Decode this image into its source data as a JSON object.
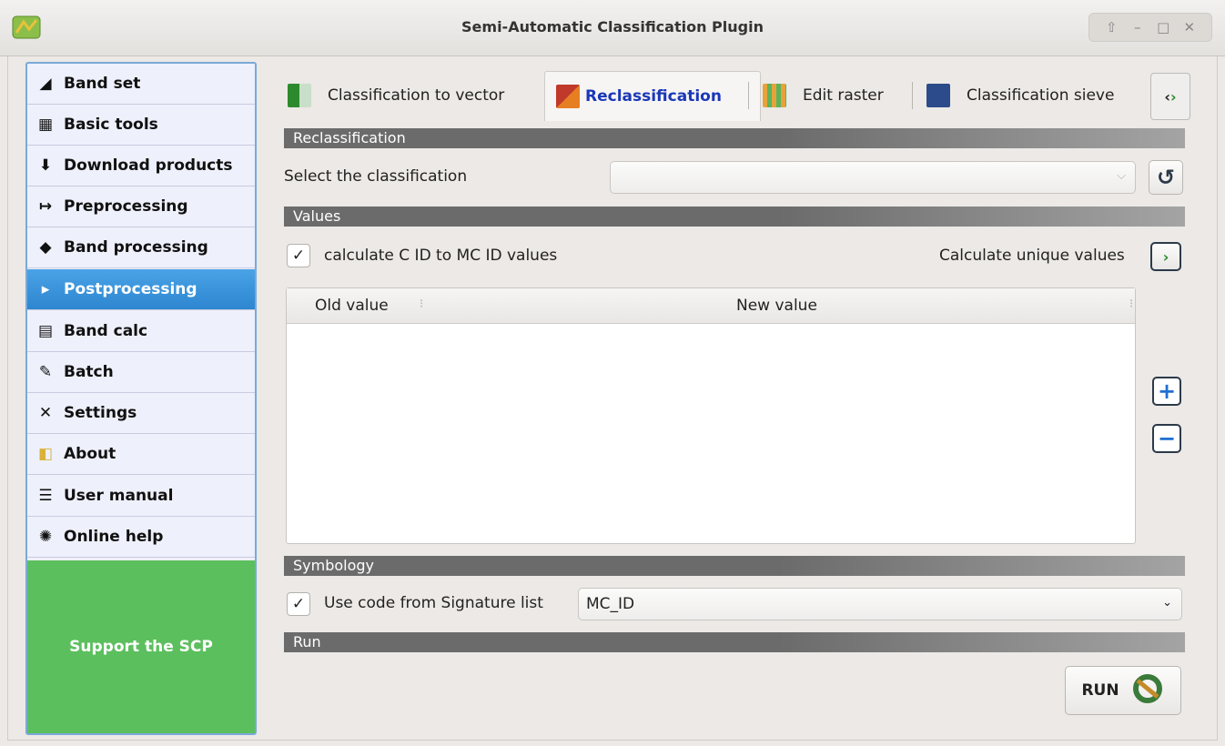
{
  "window": {
    "title": "Semi-Automatic Classification Plugin",
    "controls": [
      "⇧",
      "–",
      "□",
      "✕"
    ]
  },
  "sidebar": {
    "items": [
      {
        "label": "Band set",
        "icon": "band-set-icon"
      },
      {
        "label": "Basic tools",
        "icon": "basic-tools-icon"
      },
      {
        "label": "Download products",
        "icon": "download-icon"
      },
      {
        "label": "Preprocessing",
        "icon": "preprocessing-icon"
      },
      {
        "label": "Band processing",
        "icon": "band-processing-icon"
      },
      {
        "label": "Postprocessing",
        "icon": "postprocessing-icon",
        "active": true
      },
      {
        "label": "Band calc",
        "icon": "band-calc-icon"
      },
      {
        "label": "Batch",
        "icon": "batch-icon"
      },
      {
        "label": "Settings",
        "icon": "settings-icon"
      },
      {
        "label": "About",
        "icon": "about-icon"
      },
      {
        "label": "User manual",
        "icon": "user-manual-icon"
      },
      {
        "label": "Online help",
        "icon": "online-help-icon"
      }
    ],
    "support_label": "Support the SCP"
  },
  "tabs": [
    {
      "label": "Classification to vector",
      "icon": "classification-to-vector-icon"
    },
    {
      "label": "Reclassification",
      "icon": "reclassification-icon",
      "active": true
    },
    {
      "label": "Edit raster",
      "icon": "edit-raster-icon"
    },
    {
      "label": "Classification sieve",
      "icon": "classification-sieve-icon"
    }
  ],
  "sections": {
    "reclassification": "Reclassification",
    "values": "Values",
    "symbology": "Symbology",
    "run": "Run"
  },
  "reclassification": {
    "select_label": "Select the classification",
    "selected": ""
  },
  "values": {
    "calc_checkbox_label": "calculate C ID to MC ID values",
    "calc_checked": true,
    "unique_values_label": "Calculate unique values",
    "table": {
      "columns": [
        "Old value",
        "New value"
      ],
      "rows": []
    }
  },
  "symbology": {
    "checkbox_label": "Use code from Signature list",
    "checked": true,
    "selected": "MC_ID"
  },
  "run": {
    "button_label": "RUN"
  },
  "colors": {
    "active_sidebar": "#2d86d0",
    "support": "#5cbf5e",
    "active_tab_text": "#1a37b8"
  }
}
